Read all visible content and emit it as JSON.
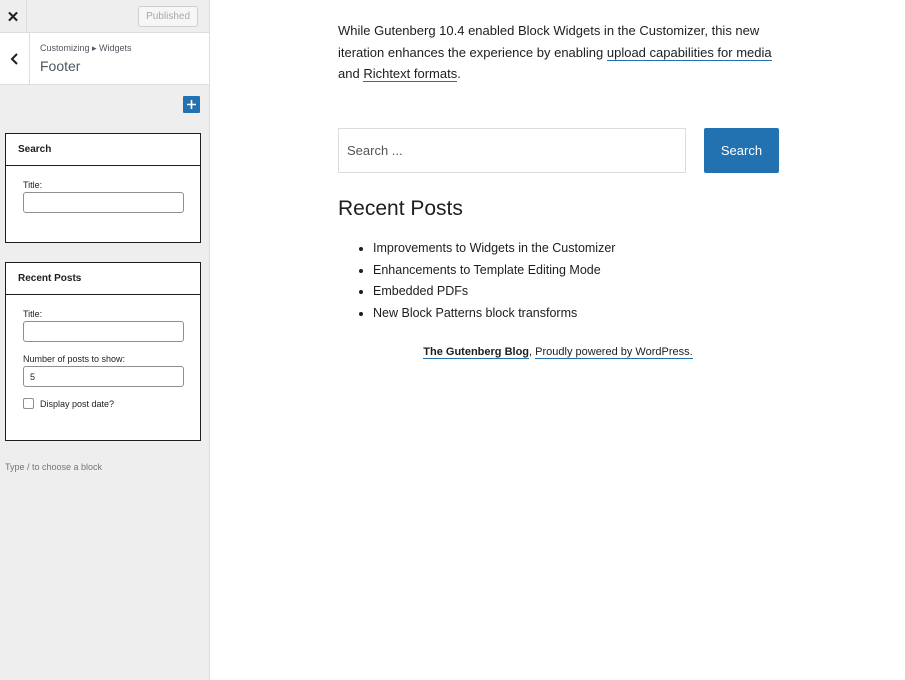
{
  "customizer": {
    "close_glyph": "✕",
    "published_label": "Published",
    "breadcrumb": "Customizing ▸ Widgets",
    "section_title": "Footer",
    "add_block_glyph": "+",
    "hint": "Type / to choose a block"
  },
  "widgets": {
    "search": {
      "title": "Search",
      "title_label": "Title:",
      "title_value": ""
    },
    "recent_posts": {
      "title": "Recent Posts",
      "title_label": "Title:",
      "title_value": "",
      "count_label": "Number of posts to show:",
      "count_value": "5",
      "show_date_label": "Display post date?",
      "show_date_checked": false
    }
  },
  "preview": {
    "intro": {
      "text1": "While Gutenberg 10.4 enabled Block Widgets in the Customizer, this new iteration enhances the experience by enabling ",
      "link1": "upload capabilities for media",
      "text2": " and ",
      "link2": "Richtext formats",
      "text3": "."
    },
    "search": {
      "placeholder": "Search ...",
      "button_label": "Search"
    },
    "recent_posts": {
      "heading": "Recent Posts",
      "items": [
        "Improvements to Widgets in the Customizer",
        "Enhancements to Template Editing Mode",
        "Embedded PDFs",
        "New Block Patterns block transforms"
      ]
    },
    "footer": {
      "blog_name": "The Gutenberg Blog",
      "separator": ", ",
      "powered_by": "Proudly powered by WordPress."
    }
  },
  "colors": {
    "accent": "#2271b1",
    "sidebar_bg": "#eeeeee",
    "text": "#1e1e1e"
  }
}
